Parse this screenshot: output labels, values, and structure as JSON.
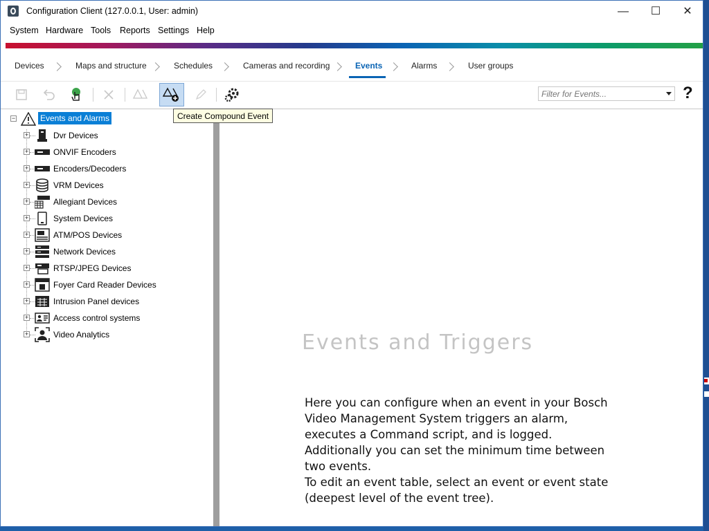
{
  "window": {
    "title": "Configuration Client (127.0.0.1, User: admin)"
  },
  "window_controls": {
    "minimize": "—",
    "maximize": "☐",
    "close": "✕"
  },
  "menu": [
    "System",
    "Hardware",
    "Tools",
    "Reports",
    "Settings",
    "Help"
  ],
  "nav": {
    "tabs": [
      "Devices",
      "Maps and structure",
      "Schedules",
      "Cameras and recording",
      "Events",
      "Alarms",
      "User groups"
    ],
    "active": "Events"
  },
  "toolbar": {
    "filter_placeholder": "Filter for Events...",
    "help_label": "?",
    "tooltip": "Create Compound Event"
  },
  "tree": {
    "root": "Events and Alarms",
    "items": [
      "Dvr Devices",
      "ONVIF Encoders",
      "Encoders/Decoders",
      "VRM Devices",
      "Allegiant Devices",
      "System Devices",
      "ATM/POS Devices",
      "Network Devices",
      "RTSP/JPEG Devices",
      "Foyer Card Reader Devices",
      "Intrusion Panel devices",
      "Access control systems",
      "Video Analytics"
    ]
  },
  "main": {
    "heading": "Events and Triggers",
    "description": [
      "Here you can configure when an event in your Bosch Video Management System triggers an alarm, executes a Command script, and is logged.",
      "Additionally you can set the minimum time between two events.",
      "To edit an event table, select an event or event state (deepest level of the event tree)."
    ]
  },
  "colors": {
    "accent": "#0a64b4",
    "selection": "#0a7fd6",
    "brand_strip": [
      "#c8102e",
      "#a3185c",
      "#5b2b86",
      "#243a8c",
      "#0a64b4",
      "#0a8ea8",
      "#0b9b6b",
      "#23a046"
    ]
  }
}
